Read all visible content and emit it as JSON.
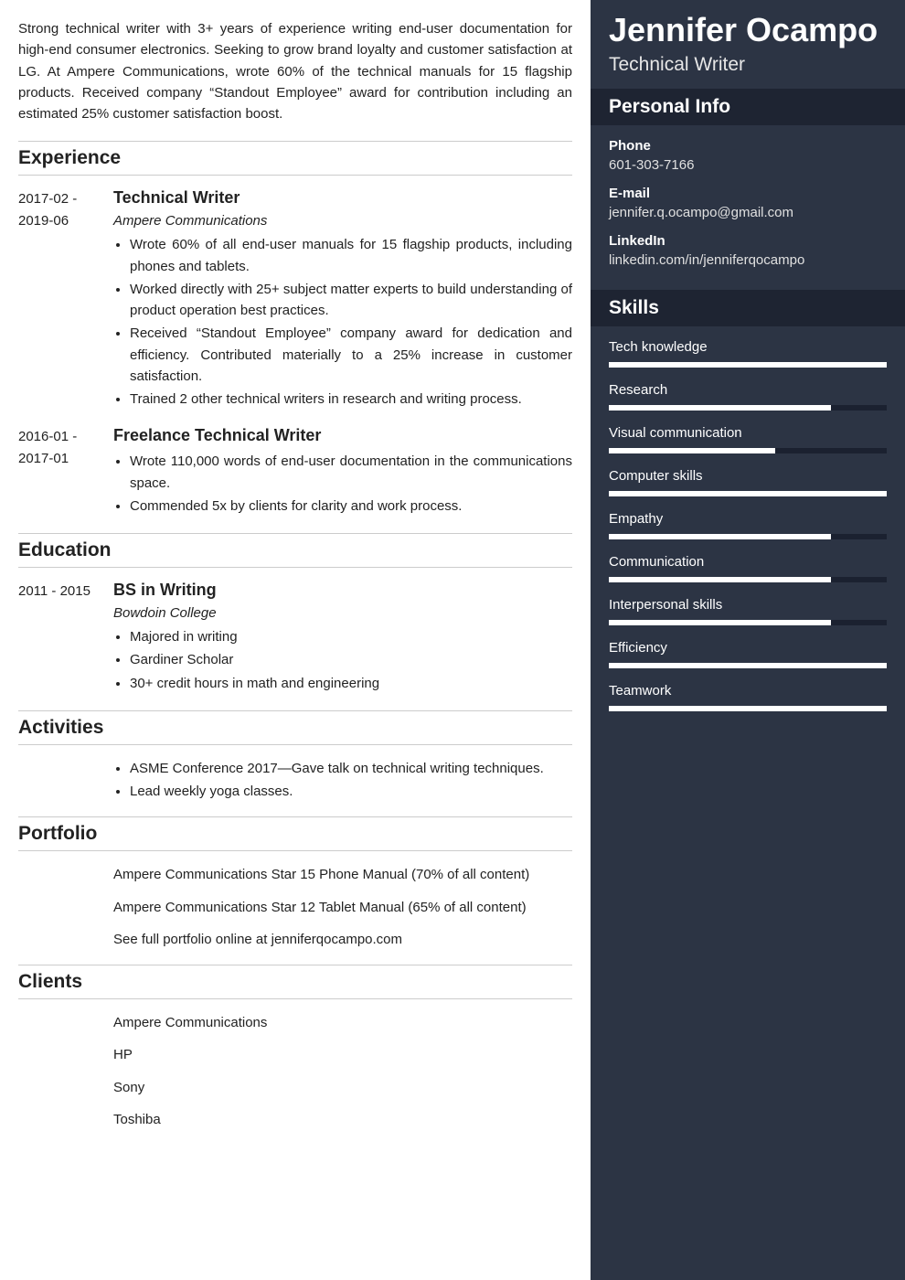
{
  "name": "Jennifer Ocampo",
  "title": "Technical Writer",
  "summary": "Strong technical writer with 3+ years of experience writing end-user documentation for high-end consumer electronics. Seeking to grow brand loyalty and customer satisfaction at LG. At Ampere Communications, wrote 60% of the technical manuals for 15 flagship products. Received company “Standout Employee” award for contribution including an estimated 25% customer satisfaction boost.",
  "sections": {
    "experience": {
      "heading": "Experience",
      "items": [
        {
          "date": "2017-02 - 2019-06",
          "title": "Technical Writer",
          "sub": "Ampere Communications",
          "bullets": [
            "Wrote 60% of all end-user manuals for 15 flagship products, including phones and tablets.",
            "Worked directly with 25+ subject matter experts to build understanding of product operation best practices.",
            "Received “Standout Employee” company award for dedication and efficiency. Contributed materially to a 25% increase in customer satisfaction.",
            "Trained 2 other technical writers in research and writing process."
          ]
        },
        {
          "date": "2016-01 - 2017-01",
          "title": "Freelance Technical Writer",
          "sub": "",
          "bullets": [
            "Wrote 110,000 words of end-user documentation in the communications space.",
            "Commended 5x by clients for clarity and work process."
          ]
        }
      ]
    },
    "education": {
      "heading": "Education",
      "items": [
        {
          "date": "2011 - 2015",
          "title": "BS in Writing",
          "sub": "Bowdoin College",
          "bullets": [
            "Majored in writing",
            "Gardiner Scholar",
            "30+ credit hours in math and engineering"
          ]
        }
      ]
    },
    "activities": {
      "heading": "Activities",
      "bullets": [
        "ASME Conference 2017—Gave talk on technical writing techniques.",
        "Lead weekly yoga classes."
      ]
    },
    "portfolio": {
      "heading": "Portfolio",
      "lines": [
        "Ampere Communications Star 15 Phone Manual (70% of all content)",
        "Ampere Communications Star 12 Tablet Manual (65% of all content)",
        "See full portfolio online at jenniferqocampo.com"
      ]
    },
    "clients": {
      "heading": "Clients",
      "lines": [
        "Ampere Communications",
        "HP",
        "Sony",
        "Toshiba"
      ]
    }
  },
  "personal_info": {
    "heading": "Personal Info",
    "items": [
      {
        "label": "Phone",
        "value": "601-303-7166"
      },
      {
        "label": "E-mail",
        "value": "jennifer.q.ocampo@gmail.com"
      },
      {
        "label": "LinkedIn",
        "value": "linkedin.com/in/jenniferqocampo"
      }
    ]
  },
  "skills": {
    "heading": "Skills",
    "items": [
      {
        "label": "Tech knowledge",
        "pct": 100
      },
      {
        "label": "Research",
        "pct": 80
      },
      {
        "label": "Visual communication",
        "pct": 60
      },
      {
        "label": "Computer skills",
        "pct": 100
      },
      {
        "label": "Empathy",
        "pct": 80
      },
      {
        "label": "Communication",
        "pct": 80
      },
      {
        "label": "Interpersonal skills",
        "pct": 80
      },
      {
        "label": "Efficiency",
        "pct": 100
      },
      {
        "label": "Teamwork",
        "pct": 100
      }
    ]
  }
}
